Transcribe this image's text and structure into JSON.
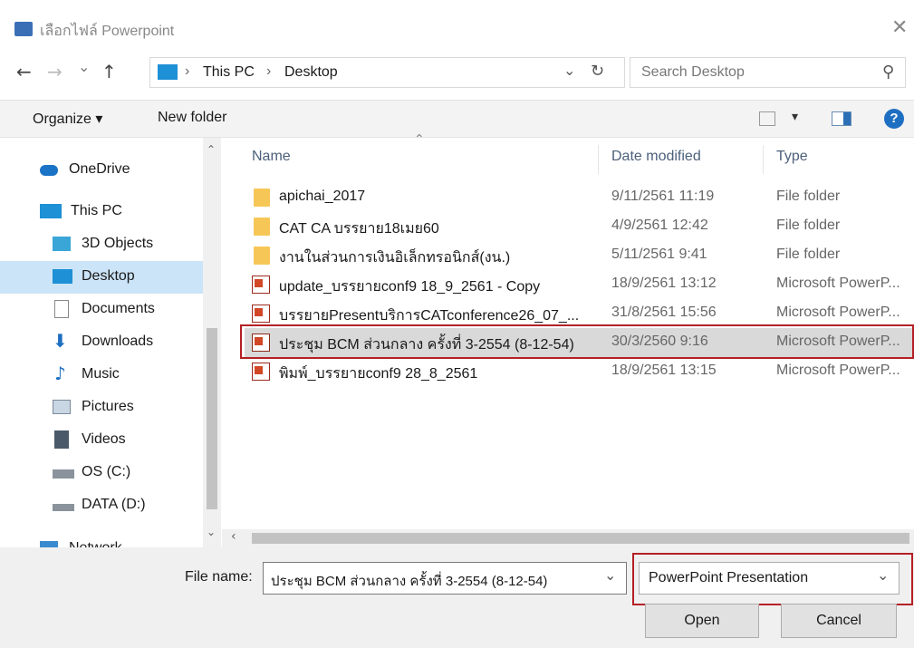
{
  "window": {
    "title": "เลือกไฟล์ Powerpoint",
    "close_glyph": "✕"
  },
  "nav": {
    "back": "←",
    "forward": "→",
    "recent": "⌄",
    "up": "↑",
    "refresh": "↻",
    "dropdown": "⌄"
  },
  "address": {
    "segments": [
      "This PC",
      "Desktop"
    ],
    "sep": "›"
  },
  "search": {
    "placeholder": "Search Desktop",
    "icon": "⚲"
  },
  "toolbar": {
    "organize": "Organize ▾",
    "new_folder": "New folder",
    "view_glyph": "▾",
    "help": "?"
  },
  "sidebar": {
    "items": [
      {
        "label": "OneDrive",
        "icon": "cloud-icon"
      },
      {
        "label": "This PC",
        "icon": "computer-icon"
      },
      {
        "label": "3D Objects",
        "icon": "cube-icon"
      },
      {
        "label": "Desktop",
        "icon": "desktop-icon",
        "selected": true
      },
      {
        "label": "Documents",
        "icon": "document-icon"
      },
      {
        "label": "Downloads",
        "icon": "download-icon"
      },
      {
        "label": "Music",
        "icon": "music-icon"
      },
      {
        "label": "Pictures",
        "icon": "picture-icon"
      },
      {
        "label": "Videos",
        "icon": "video-icon"
      },
      {
        "label": "OS (C:)",
        "icon": "drive-icon"
      },
      {
        "label": "DATA (D:)",
        "icon": "drive-icon"
      },
      {
        "label": "Network",
        "icon": "network-icon"
      }
    ]
  },
  "files": {
    "columns": {
      "name": "Name",
      "date": "Date modified",
      "type": "Type"
    },
    "rows": [
      {
        "name": "apichai_2017",
        "date": "9/11/2561 11:19",
        "type": "File folder",
        "kind": "folder"
      },
      {
        "name": "CAT CA บรรยาย18เมย60",
        "date": "4/9/2561 12:42",
        "type": "File folder",
        "kind": "folder"
      },
      {
        "name": "งานในส่วนการเงินอิเล็กทรอนิกส์(งน.)",
        "date": "5/11/2561 9:41",
        "type": "File folder",
        "kind": "folder"
      },
      {
        "name": "update_บรรยายconf9 18_9_2561 - Copy",
        "date": "18/9/2561 13:12",
        "type": "Microsoft PowerP...",
        "kind": "ppt"
      },
      {
        "name": "บรรยายPresentบริการCATconference26_07_...",
        "date": "31/8/2561 15:56",
        "type": "Microsoft PowerP...",
        "kind": "ppt"
      },
      {
        "name": "ประชุม BCM ส่วนกลาง ครั้งที่ 3-2554 (8-12-54)",
        "date": "30/3/2560 9:16",
        "type": "Microsoft PowerP...",
        "kind": "ppt",
        "selected": true
      },
      {
        "name": "พิมพ์_บรรยายconf9 28_8_2561",
        "date": "18/9/2561 13:15",
        "type": "Microsoft PowerP...",
        "kind": "ppt"
      }
    ]
  },
  "footer": {
    "filename_label": "File name:",
    "filename_value": "ประชุม BCM ส่วนกลาง ครั้งที่ 3-2554 (8-12-54)",
    "filetype_value": "PowerPoint Presentation",
    "open_label": "Open",
    "cancel_label": "Cancel",
    "dropdown_glyph": "⌄"
  }
}
